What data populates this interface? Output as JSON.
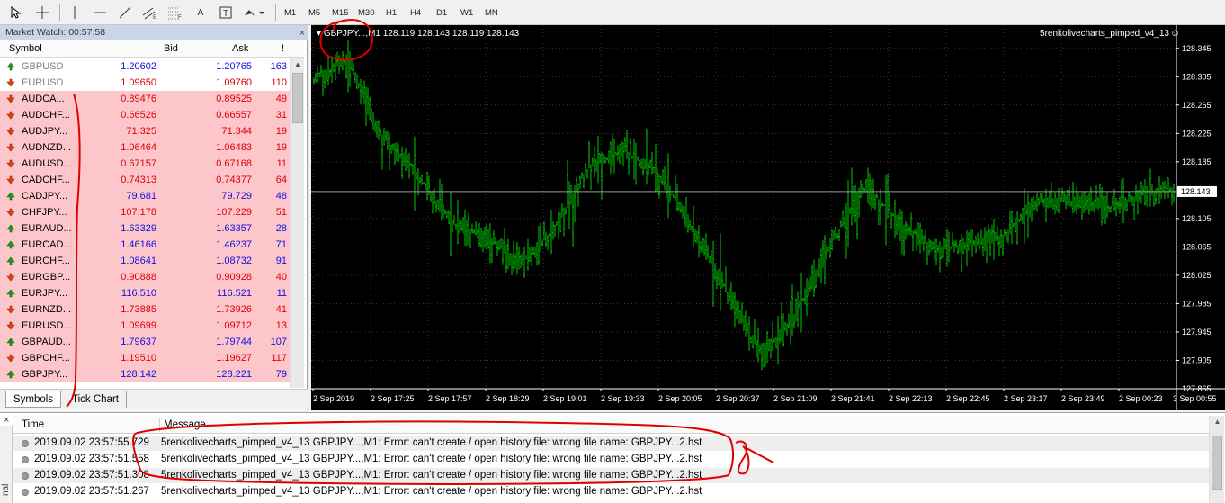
{
  "toolbar": {
    "timeframes": [
      "M1",
      "M5",
      "M15",
      "M30",
      "H1",
      "H4",
      "D1",
      "W1",
      "MN"
    ],
    "text_tool": "A"
  },
  "market_watch": {
    "title": "Market Watch: 00:57:58",
    "close_glyph": "×",
    "col_symbol": "Symbol",
    "col_bid": "Bid",
    "col_ask": "Ask",
    "col_spread": "!",
    "rows": [
      {
        "symbol": "GBPUSD",
        "bid": "1.20602",
        "ask": "1.20765",
        "spread": "163",
        "dir": "up",
        "color": "#1010e0",
        "symcolor": "#808080",
        "bg": "plain"
      },
      {
        "symbol": "EURUSD",
        "bid": "1.09650",
        "ask": "1.09760",
        "spread": "110",
        "dir": "down",
        "color": "#e00000",
        "symcolor": "#808080",
        "bg": "plain"
      },
      {
        "symbol": "AUDCA...",
        "bid": "0.89476",
        "ask": "0.89525",
        "spread": "49",
        "dir": "down",
        "color": "#e00000",
        "symcolor": "#000",
        "bg": "sel"
      },
      {
        "symbol": "AUDCHF...",
        "bid": "0.66526",
        "ask": "0.66557",
        "spread": "31",
        "dir": "down",
        "color": "#e00000",
        "symcolor": "#000",
        "bg": "sel"
      },
      {
        "symbol": "AUDJPY...",
        "bid": "71.325",
        "ask": "71.344",
        "spread": "19",
        "dir": "down",
        "color": "#e00000",
        "symcolor": "#000",
        "bg": "sel"
      },
      {
        "symbol": "AUDNZD...",
        "bid": "1.06464",
        "ask": "1.06483",
        "spread": "19",
        "dir": "down",
        "color": "#e00000",
        "symcolor": "#000",
        "bg": "sel"
      },
      {
        "symbol": "AUDUSD...",
        "bid": "0.67157",
        "ask": "0.67168",
        "spread": "11",
        "dir": "down",
        "color": "#e00000",
        "symcolor": "#000",
        "bg": "sel"
      },
      {
        "symbol": "CADCHF...",
        "bid": "0.74313",
        "ask": "0.74377",
        "spread": "64",
        "dir": "down",
        "color": "#e00000",
        "symcolor": "#000",
        "bg": "sel"
      },
      {
        "symbol": "CADJPY...",
        "bid": "79.681",
        "ask": "79.729",
        "spread": "48",
        "dir": "up",
        "color": "#1010e0",
        "symcolor": "#000",
        "bg": "sel"
      },
      {
        "symbol": "CHFJPY...",
        "bid": "107.178",
        "ask": "107.229",
        "spread": "51",
        "dir": "down",
        "color": "#e00000",
        "symcolor": "#000",
        "bg": "sel"
      },
      {
        "symbol": "EURAUD...",
        "bid": "1.63329",
        "ask": "1.63357",
        "spread": "28",
        "dir": "up",
        "color": "#1010e0",
        "symcolor": "#000",
        "bg": "sel"
      },
      {
        "symbol": "EURCAD...",
        "bid": "1.46166",
        "ask": "1.46237",
        "spread": "71",
        "dir": "up",
        "color": "#1010e0",
        "symcolor": "#000",
        "bg": "sel"
      },
      {
        "symbol": "EURCHF...",
        "bid": "1.08641",
        "ask": "1.08732",
        "spread": "91",
        "dir": "up",
        "color": "#1010e0",
        "symcolor": "#000",
        "bg": "sel"
      },
      {
        "symbol": "EURGBP...",
        "bid": "0.90888",
        "ask": "0.90928",
        "spread": "40",
        "dir": "down",
        "color": "#e00000",
        "symcolor": "#000",
        "bg": "sel"
      },
      {
        "symbol": "EURJPY...",
        "bid": "116.510",
        "ask": "116.521",
        "spread": "11",
        "dir": "up",
        "color": "#1010e0",
        "symcolor": "#000",
        "bg": "sel"
      },
      {
        "symbol": "EURNZD...",
        "bid": "1.73885",
        "ask": "1.73926",
        "spread": "41",
        "dir": "down",
        "color": "#e00000",
        "symcolor": "#000",
        "bg": "sel"
      },
      {
        "symbol": "EURUSD...",
        "bid": "1.09699",
        "ask": "1.09712",
        "spread": "13",
        "dir": "down",
        "color": "#e00000",
        "symcolor": "#000",
        "bg": "sel"
      },
      {
        "symbol": "GBPAUD...",
        "bid": "1.79637",
        "ask": "1.79744",
        "spread": "107",
        "dir": "up",
        "color": "#1010e0",
        "symcolor": "#000",
        "bg": "sel"
      },
      {
        "symbol": "GBPCHF...",
        "bid": "1.19510",
        "ask": "1.19627",
        "spread": "117",
        "dir": "down",
        "color": "#e00000",
        "symcolor": "#000",
        "bg": "sel"
      },
      {
        "symbol": "GBPJPY...",
        "bid": "128.142",
        "ask": "128.221",
        "spread": "79",
        "dir": "up",
        "color": "#1010e0",
        "symcolor": "#000",
        "bg": "sel"
      }
    ],
    "tab_symbols": "Symbols",
    "tab_tick": "Tick Chart"
  },
  "chart": {
    "info": "GBPJPY...,M1  128.119 128.143 128.119 128.143",
    "indicator": "5renkolivecharts_pimped_v4_13",
    "smile": "☺",
    "current_price": "128.143",
    "price_labels": [
      "128.345",
      "128.305",
      "128.265",
      "128.225",
      "128.185",
      "128.105",
      "128.065",
      "128.025",
      "127.985",
      "127.945",
      "127.905",
      "127.865"
    ],
    "time_labels": [
      "2 Sep 2019",
      "2 Sep 17:25",
      "2 Sep 17:57",
      "2 Sep 18:29",
      "2 Sep 19:01",
      "2 Sep 19:33",
      "2 Sep 20:05",
      "2 Sep 20:37",
      "2 Sep 21:09",
      "2 Sep 21:41",
      "2 Sep 22:13",
      "2 Sep 22:45",
      "2 Sep 23:17",
      "2 Sep 23:49",
      "2 Sep 00:23",
      "3 Sep 00:55"
    ],
    "bar_color": "#00c800",
    "grid_color": "#3a3a3a"
  },
  "chart_data": {
    "type": "line",
    "xlabel": "",
    "ylabel": "",
    "ylim": [
      127.865,
      128.365
    ],
    "x": [
      0,
      4,
      8,
      12,
      16,
      20,
      24,
      28,
      32,
      36,
      40,
      44,
      48,
      52,
      56,
      60,
      64,
      68,
      72,
      76,
      80,
      84,
      88,
      92,
      96,
      100
    ],
    "series": [
      {
        "values": [
          128.3,
          128.33,
          128.22,
          128.17,
          128.1,
          128.08,
          128.04,
          128.09,
          128.18,
          128.2,
          128.17,
          128.09,
          128.0,
          127.91,
          127.97,
          128.07,
          128.15,
          128.1,
          128.06,
          128.07,
          128.08,
          128.13,
          128.13,
          128.12,
          128.14,
          128.15
        ]
      }
    ]
  },
  "terminal": {
    "close_glyph": "×",
    "side_label": "nal",
    "col_time": "Time",
    "col_message": "Message",
    "rows": [
      {
        "time": "2019.09.02 23:57:55.729",
        "message": "5renkolivecharts_pimped_v4_13 GBPJPY...,M1: Error: can't create / open history file: wrong file name: GBPJPY...2.hst"
      },
      {
        "time": "2019.09.02 23:57:51.558",
        "message": "5renkolivecharts_pimped_v4_13 GBPJPY...,M1: Error: can't create / open history file: wrong file name: GBPJPY...2.hst"
      },
      {
        "time": "2019.09.02 23:57:51.308",
        "message": "5renkolivecharts_pimped_v4_13 GBPJPY...,M1: Error: can't create / open history file: wrong file name: GBPJPY...2.hst"
      },
      {
        "time": "2019.09.02 23:57:51.267",
        "message": "5renkolivecharts_pimped_v4_13 GBPJPY...,M1: Error: can't create / open history file: wrong file name: GBPJPY...2.hst"
      }
    ]
  }
}
